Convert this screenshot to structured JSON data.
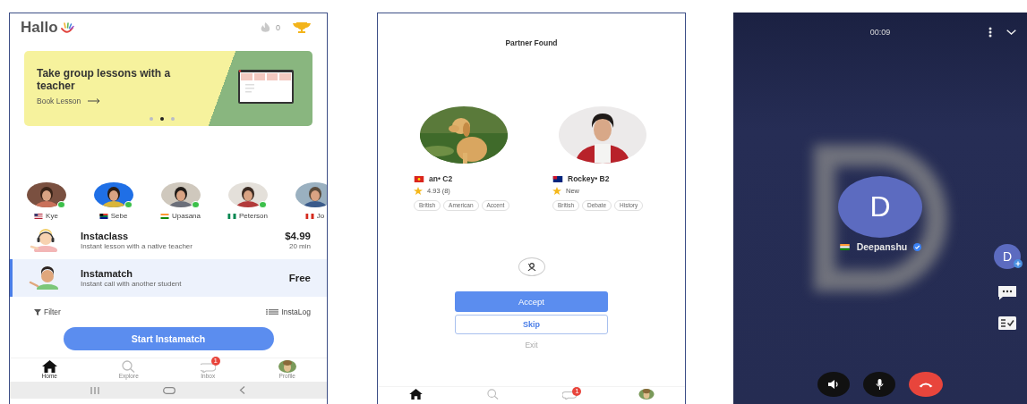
{
  "home": {
    "logo": "Hallo",
    "streak_count": "0",
    "banner": {
      "title": "Take group lessons with a teacher",
      "link": "Book Lesson",
      "dots": [
        {
          "selected": false
        },
        {
          "selected": true
        },
        {
          "selected": false
        }
      ]
    },
    "people": [
      {
        "name": "Kye",
        "flag": {
          "kind": "us"
        },
        "online": true
      },
      {
        "name": "Sebe",
        "flag": {
          "kind": "za"
        },
        "online": true
      },
      {
        "name": "Upasana",
        "flag": {
          "kind": "in"
        },
        "online": true
      },
      {
        "name": "Peterson",
        "flag": {
          "kind": "ng"
        },
        "online": true
      },
      {
        "name": "Jo",
        "flag": {
          "kind": "ca"
        }
      }
    ],
    "offerings": [
      {
        "kind": "instaclass",
        "title": "Instaclass",
        "subtitle": "Instant lesson with a native teacher",
        "price": "$4.99",
        "duration": "20 min",
        "selected": false
      },
      {
        "kind": "instamatch",
        "title": "Instamatch",
        "subtitle": "Instant call with another student",
        "price": "Free",
        "selected": true
      }
    ],
    "filter": "Filter",
    "log": "InstaLog",
    "start_button": "Start Instamatch",
    "nav": [
      {
        "kind": "home",
        "label": "Home",
        "selected": true
      },
      {
        "kind": "explore",
        "label": "Explore",
        "selected": false
      },
      {
        "kind": "inbox",
        "label": "Inbox",
        "selected": false,
        "badge": "1"
      },
      {
        "kind": "profile",
        "label": "Profile",
        "selected": false
      }
    ]
  },
  "partner_found": {
    "title": "Partner Found",
    "partners": [
      {
        "kind": "dog",
        "name": "an• C2",
        "flag": {
          "kind": "vn"
        },
        "rating": "4.93 (8)",
        "tags": [
          "British",
          "American",
          "Accent"
        ]
      },
      {
        "kind": "person",
        "name": "Rockey• B2",
        "flag": {
          "kind": "nz"
        },
        "rating": "New",
        "tags": [
          "British",
          "Debate",
          "History"
        ]
      }
    ],
    "accept": "Accept",
    "skip": "Skip",
    "exit": "Exit",
    "nav": [
      {
        "kind": "home",
        "selected": true
      },
      {
        "kind": "explore",
        "selected": false
      },
      {
        "kind": "inbox",
        "selected": false,
        "badge": "1"
      },
      {
        "kind": "profile",
        "selected": false
      }
    ]
  },
  "call": {
    "timer": "00:09",
    "avatar_letter": "D",
    "flag": {
      "kind": "in"
    },
    "name": "Deepanshu",
    "verified": true,
    "side_avatar_letter": "D",
    "controls": [
      {
        "kind": "speaker"
      },
      {
        "kind": "mic"
      },
      {
        "kind": "hangup"
      }
    ]
  }
}
